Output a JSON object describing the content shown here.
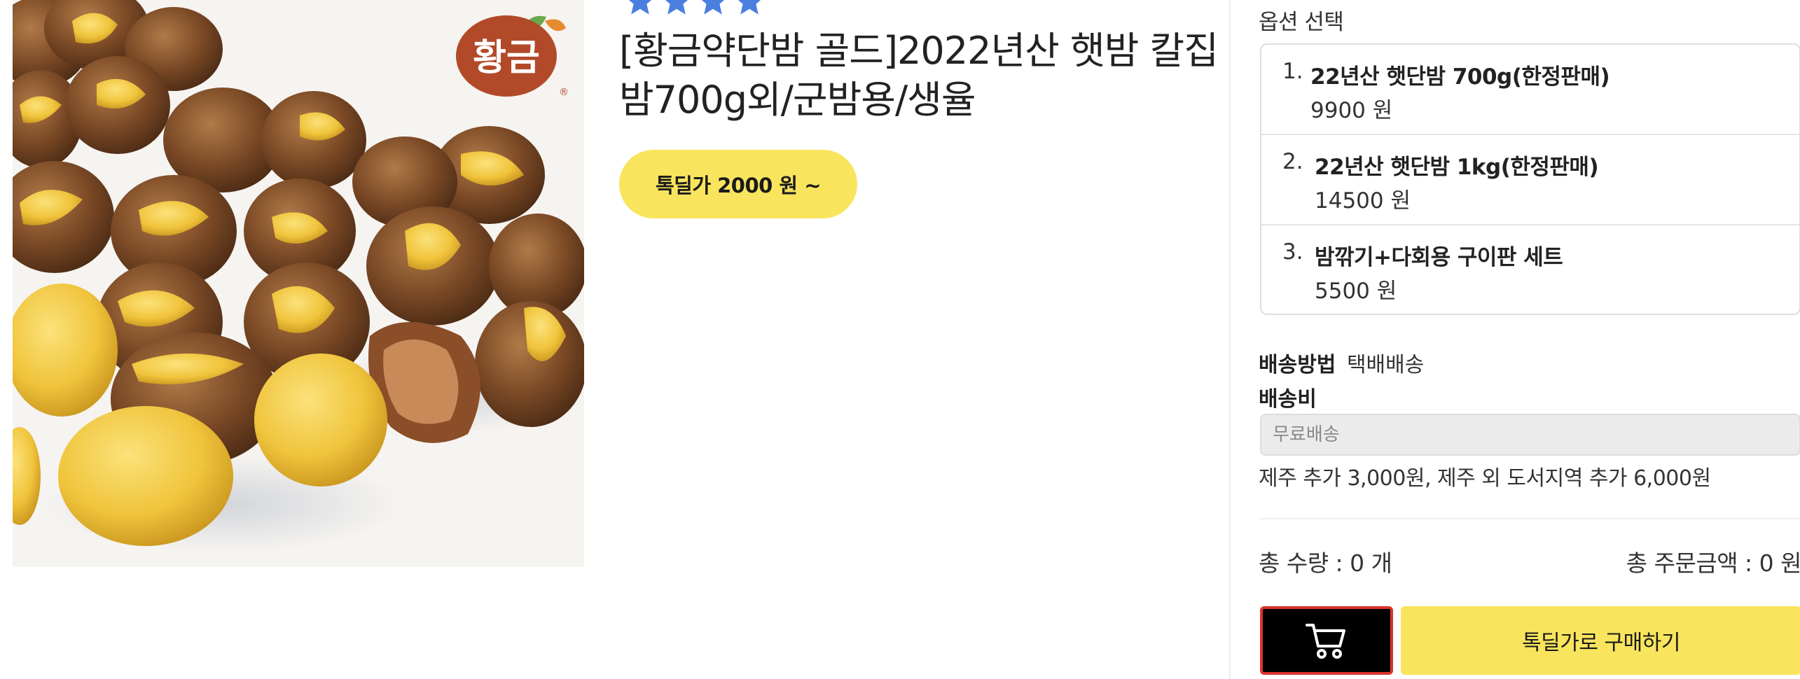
{
  "product": {
    "image_logo_text": "황금",
    "rating_stars": 4,
    "title": "[황금약단밤 골드]2022년산 햇밤 칼집밤700g외/군밤용/생율",
    "deal_price_label": "톡딜가 2000 원 ~"
  },
  "options": {
    "heading": "옵션 선택",
    "items": [
      {
        "index": "1.",
        "name": "22년산 햇단밤 700g(한정판매)",
        "price": "9900 원"
      },
      {
        "index": "2.",
        "name": "22년산 햇단밤 1kg(한정판매)",
        "price": "14500 원"
      },
      {
        "index": "3.",
        "name": "밤깎기+다회용 구이판 세트",
        "price": "5500 원"
      }
    ]
  },
  "shipping": {
    "method_label": "배송방법",
    "method_value": "택배배송",
    "fee_label": "배송비",
    "fee_placeholder": "무료배송",
    "extra_note": "제주 추가 3,000원, 제주 외 도서지역 추가 6,000원"
  },
  "summary": {
    "total_quantity": "총 수량 : 0 개",
    "total_amount": "총 주문금액 : 0 원"
  },
  "actions": {
    "cart_icon": "cart-icon",
    "buy_label": "톡딜가로 구매하기"
  },
  "colors": {
    "accent_yellow": "#f9e45d",
    "star_blue": "#4a7fe0",
    "cart_border_red": "#d9342b",
    "logo_brown": "#b24a2a"
  }
}
